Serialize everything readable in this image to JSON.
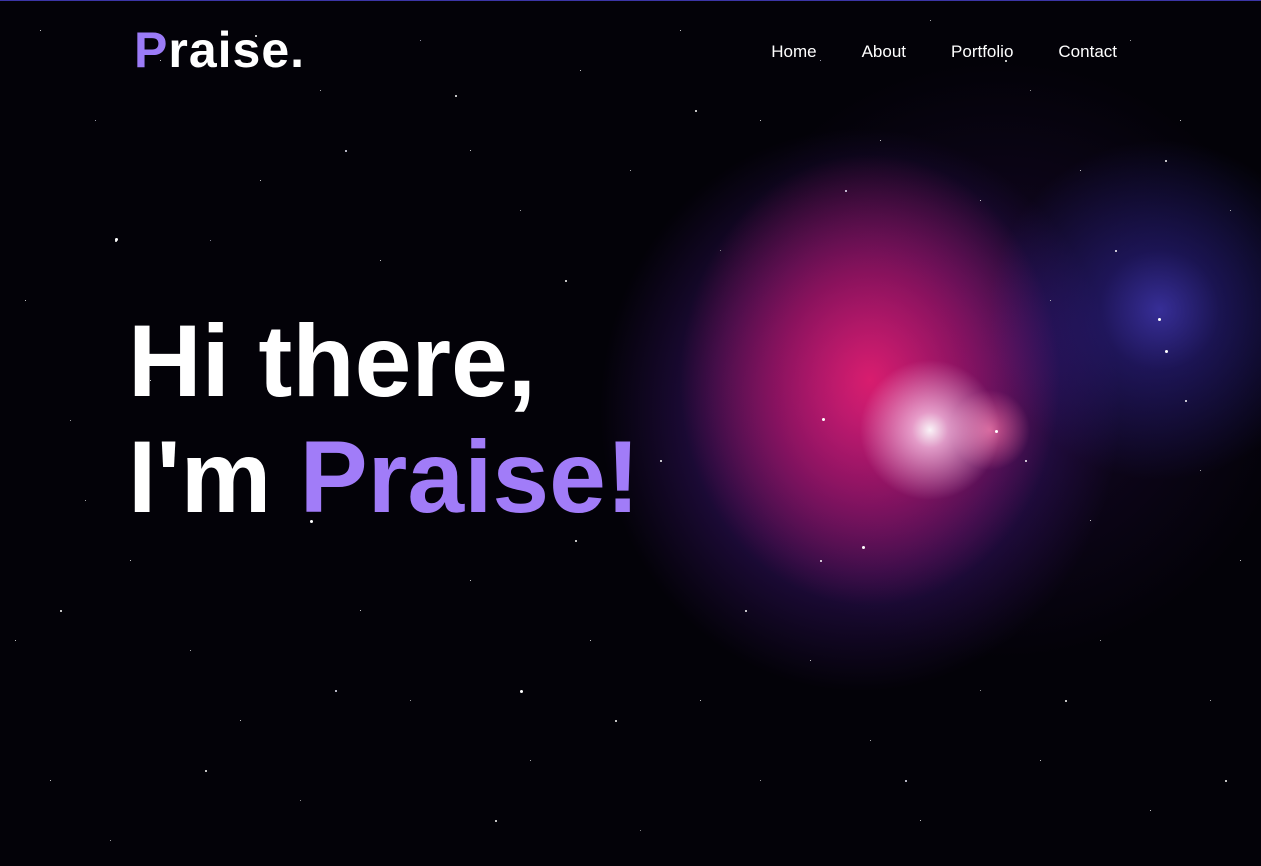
{
  "logo": {
    "initial": "P",
    "rest": "raise",
    "dot": "."
  },
  "nav": {
    "items": [
      {
        "label": "Home"
      },
      {
        "label": "About"
      },
      {
        "label": "Portfolio"
      },
      {
        "label": "Contact"
      }
    ]
  },
  "hero": {
    "line1": "Hi there,",
    "line2_prefix": "I'm ",
    "name": "Praise!"
  },
  "colors": {
    "accent": "#a17cf8",
    "background": "#030208",
    "text": "#ffffff"
  }
}
